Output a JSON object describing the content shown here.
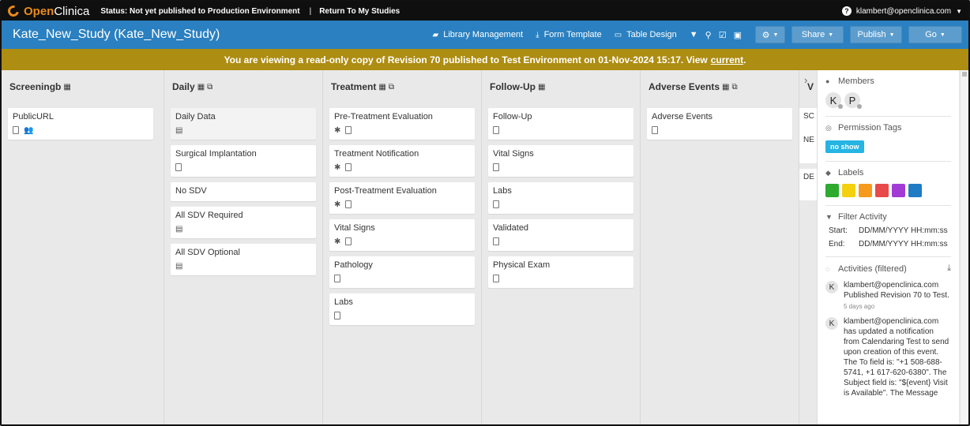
{
  "topbar": {
    "logo_part1": "Open",
    "logo_part2": "Clinica",
    "status": "Status: Not yet published to Production Environment",
    "separator": "|",
    "return_link": "Return To My Studies",
    "user": "klambert@openclinica.com"
  },
  "header": {
    "title": "Kate_New_Study (Kate_New_Study)",
    "library": "Library Management",
    "form_template": "Form Template",
    "table_design": "Table Design",
    "share": "Share",
    "publish": "Publish",
    "go": "Go"
  },
  "banner": {
    "text": "You are viewing a read-only copy of Revision 70 published to Test Environment on 01-Nov-2024 15:17. View",
    "link": "current",
    "end": "."
  },
  "columns": [
    {
      "title": "Screeningb",
      "cards": [
        {
          "name": "PublicURL"
        }
      ]
    },
    {
      "title": "Daily",
      "cards": [
        {
          "name": "Daily Data"
        },
        {
          "name": "Surgical Implantation"
        },
        {
          "name": "No SDV"
        },
        {
          "name": "All SDV Required"
        },
        {
          "name": "All SDV Optional"
        }
      ]
    },
    {
      "title": "Treatment",
      "cards": [
        {
          "name": "Pre-Treatment Evaluation"
        },
        {
          "name": "Treatment Notification"
        },
        {
          "name": "Post-Treatment Evaluation"
        },
        {
          "name": "Vital Signs"
        },
        {
          "name": "Pathology"
        },
        {
          "name": "Labs"
        }
      ]
    },
    {
      "title": "Follow-Up",
      "cards": [
        {
          "name": "Follow-Up"
        },
        {
          "name": "Vital Signs"
        },
        {
          "name": "Labs"
        },
        {
          "name": "Validated"
        },
        {
          "name": "Physical Exam"
        }
      ]
    },
    {
      "title": "Adverse Events",
      "cards": [
        {
          "name": "Adverse Events"
        }
      ]
    }
  ],
  "cut_column": {
    "title": "V",
    "cards": [
      "SC",
      "NE",
      "DE"
    ]
  },
  "panel": {
    "members_title": "Members",
    "members": [
      "K",
      "P"
    ],
    "perm_title": "Permission Tags",
    "perm_tag": "no show",
    "labels_title": "Labels",
    "label_colors": [
      "#2eaa2e",
      "#f3d10f",
      "#f59a1c",
      "#e84a4a",
      "#a23bd6",
      "#1f7bc4"
    ],
    "filter_title": "Filter Activity",
    "start_label": "Start:",
    "start_value": "DD/MM/YYYY HH:mm:ss",
    "end_label": "End:",
    "end_value": "DD/MM/YYYY HH:mm:ss",
    "activities_title": "Activities (filtered)",
    "activities": [
      {
        "avatar": "K",
        "text": "klambert@openclinica.com Published Revision 70 to Test.",
        "time": "5 days ago"
      },
      {
        "avatar": "K",
        "text": "klambert@openclinica.com has updated a notification from Calendaring Test to send upon creation of this event. The To field is: \"+1 508-688-5741, +1 617-620-6380\". The Subject field is: \"${event} Visit is Available\". The Message",
        "time": ""
      }
    ]
  }
}
